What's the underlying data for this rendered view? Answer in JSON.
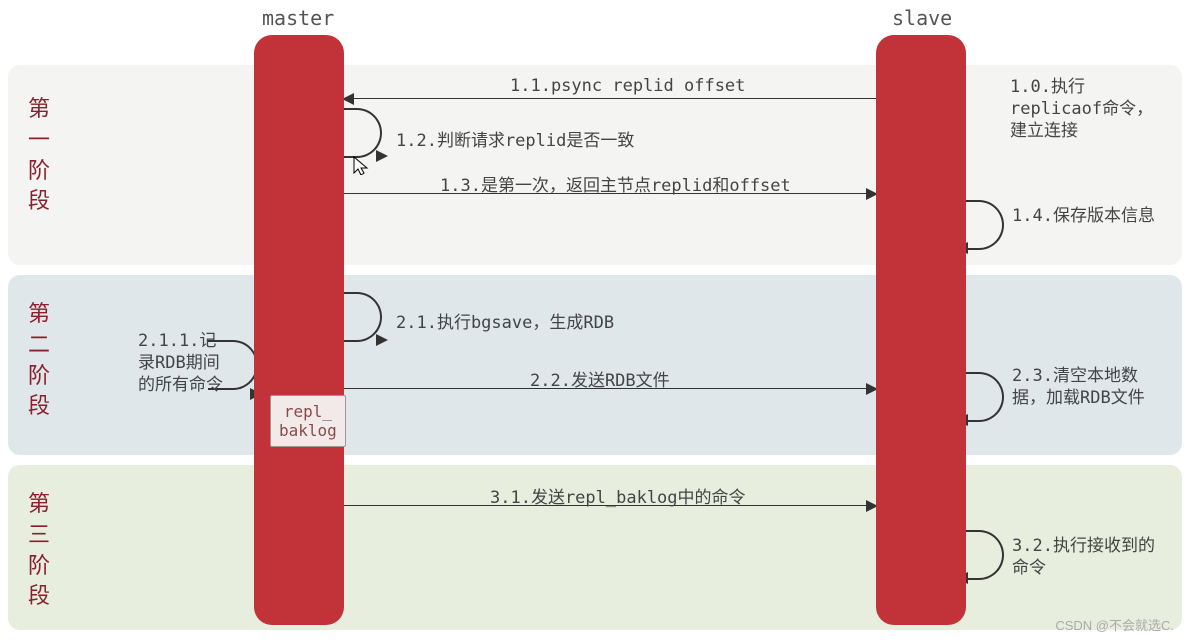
{
  "chart_data": {
    "type": "sequence_diagram",
    "participants": [
      "master",
      "slave"
    ],
    "phases": [
      {
        "name": "第一阶段",
        "steps": [
          {
            "id": "1.0",
            "actor": "slave",
            "type": "note",
            "text": "1.0.执行replicaof命令，建立连接"
          },
          {
            "id": "1.1",
            "from": "slave",
            "to": "master",
            "text": "1.1.psync replid offset"
          },
          {
            "id": "1.2",
            "actor": "master",
            "type": "self",
            "text": "1.2.判断请求replid是否一致"
          },
          {
            "id": "1.3",
            "from": "master",
            "to": "slave",
            "text": "1.3.是第一次，返回主节点replid和offset"
          },
          {
            "id": "1.4",
            "actor": "slave",
            "type": "self",
            "text": "1.4.保存版本信息"
          }
        ]
      },
      {
        "name": "第二阶段",
        "steps": [
          {
            "id": "2.1",
            "actor": "master",
            "type": "self",
            "text": "2.1.执行bgsave，生成RDB"
          },
          {
            "id": "2.1.1",
            "actor": "master",
            "type": "note",
            "text": "2.1.1.记录RDB期间的所有命令",
            "target": "repl_baklog"
          },
          {
            "id": "2.2",
            "from": "master",
            "to": "slave",
            "text": "2.2.发送RDB文件"
          },
          {
            "id": "2.3",
            "actor": "slave",
            "type": "self",
            "text": "2.3.清空本地数据，加载RDB文件"
          }
        ]
      },
      {
        "name": "第三阶段",
        "steps": [
          {
            "id": "3.1",
            "from": "master",
            "to": "slave",
            "text": "3.1.发送repl_baklog中的命令"
          },
          {
            "id": "3.2",
            "actor": "slave",
            "type": "self",
            "text": "3.2.执行接收到的命令"
          }
        ]
      }
    ]
  },
  "headers": {
    "master": "master",
    "slave": "slave"
  },
  "phases": {
    "p1": "第\n一\n阶\n段",
    "p2": "第\n二\n阶\n段",
    "p3": "第\n三\n阶\n段"
  },
  "msgs": {
    "m11": "1.1.psync replid offset",
    "m12": "1.2.判断请求replid是否一致",
    "m13": "1.3.是第一次，返回主节点replid和offset",
    "m21": "2.1.执行bgsave，生成RDB",
    "m22": "2.2.发送RDB文件",
    "m31": "3.1.发送repl_baklog中的命令"
  },
  "notes": {
    "n10": "1.0.执行replicaof命令，建立连接",
    "n14": "1.4.保存版本信息",
    "n211": "2.1.1.记录RDB期间的所有命令",
    "n23": "2.3.清空本地数据，加载RDB文件",
    "n32": "3.2.执行接收到的命令"
  },
  "repl_box": "repl_\nbaklog",
  "watermark": "CSDN @不会就选C."
}
